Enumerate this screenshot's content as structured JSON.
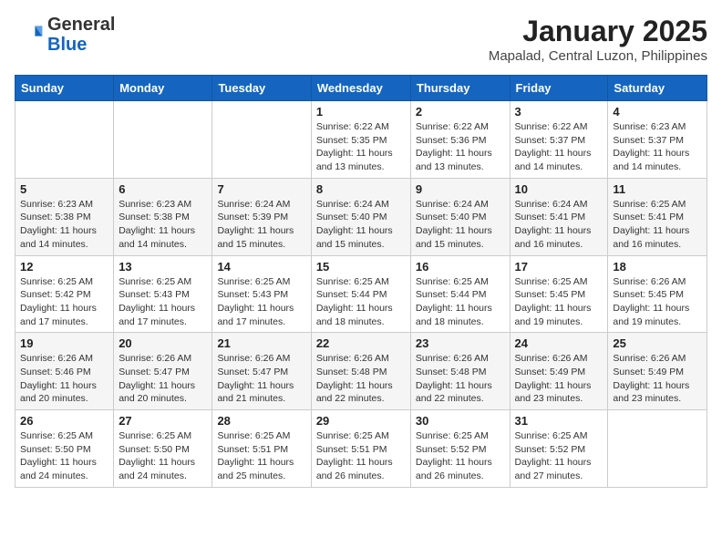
{
  "header": {
    "logo_general": "General",
    "logo_blue": "Blue",
    "month_title": "January 2025",
    "location": "Mapalad, Central Luzon, Philippines"
  },
  "days_of_week": [
    "Sunday",
    "Monday",
    "Tuesday",
    "Wednesday",
    "Thursday",
    "Friday",
    "Saturday"
  ],
  "weeks": [
    [
      {
        "day": "",
        "info": ""
      },
      {
        "day": "",
        "info": ""
      },
      {
        "day": "",
        "info": ""
      },
      {
        "day": "1",
        "info": "Sunrise: 6:22 AM\nSunset: 5:35 PM\nDaylight: 11 hours and 13 minutes."
      },
      {
        "day": "2",
        "info": "Sunrise: 6:22 AM\nSunset: 5:36 PM\nDaylight: 11 hours and 13 minutes."
      },
      {
        "day": "3",
        "info": "Sunrise: 6:22 AM\nSunset: 5:37 PM\nDaylight: 11 hours and 14 minutes."
      },
      {
        "day": "4",
        "info": "Sunrise: 6:23 AM\nSunset: 5:37 PM\nDaylight: 11 hours and 14 minutes."
      }
    ],
    [
      {
        "day": "5",
        "info": "Sunrise: 6:23 AM\nSunset: 5:38 PM\nDaylight: 11 hours and 14 minutes."
      },
      {
        "day": "6",
        "info": "Sunrise: 6:23 AM\nSunset: 5:38 PM\nDaylight: 11 hours and 14 minutes."
      },
      {
        "day": "7",
        "info": "Sunrise: 6:24 AM\nSunset: 5:39 PM\nDaylight: 11 hours and 15 minutes."
      },
      {
        "day": "8",
        "info": "Sunrise: 6:24 AM\nSunset: 5:40 PM\nDaylight: 11 hours and 15 minutes."
      },
      {
        "day": "9",
        "info": "Sunrise: 6:24 AM\nSunset: 5:40 PM\nDaylight: 11 hours and 15 minutes."
      },
      {
        "day": "10",
        "info": "Sunrise: 6:24 AM\nSunset: 5:41 PM\nDaylight: 11 hours and 16 minutes."
      },
      {
        "day": "11",
        "info": "Sunrise: 6:25 AM\nSunset: 5:41 PM\nDaylight: 11 hours and 16 minutes."
      }
    ],
    [
      {
        "day": "12",
        "info": "Sunrise: 6:25 AM\nSunset: 5:42 PM\nDaylight: 11 hours and 17 minutes."
      },
      {
        "day": "13",
        "info": "Sunrise: 6:25 AM\nSunset: 5:43 PM\nDaylight: 11 hours and 17 minutes."
      },
      {
        "day": "14",
        "info": "Sunrise: 6:25 AM\nSunset: 5:43 PM\nDaylight: 11 hours and 17 minutes."
      },
      {
        "day": "15",
        "info": "Sunrise: 6:25 AM\nSunset: 5:44 PM\nDaylight: 11 hours and 18 minutes."
      },
      {
        "day": "16",
        "info": "Sunrise: 6:25 AM\nSunset: 5:44 PM\nDaylight: 11 hours and 18 minutes."
      },
      {
        "day": "17",
        "info": "Sunrise: 6:25 AM\nSunset: 5:45 PM\nDaylight: 11 hours and 19 minutes."
      },
      {
        "day": "18",
        "info": "Sunrise: 6:26 AM\nSunset: 5:45 PM\nDaylight: 11 hours and 19 minutes."
      }
    ],
    [
      {
        "day": "19",
        "info": "Sunrise: 6:26 AM\nSunset: 5:46 PM\nDaylight: 11 hours and 20 minutes."
      },
      {
        "day": "20",
        "info": "Sunrise: 6:26 AM\nSunset: 5:47 PM\nDaylight: 11 hours and 20 minutes."
      },
      {
        "day": "21",
        "info": "Sunrise: 6:26 AM\nSunset: 5:47 PM\nDaylight: 11 hours and 21 minutes."
      },
      {
        "day": "22",
        "info": "Sunrise: 6:26 AM\nSunset: 5:48 PM\nDaylight: 11 hours and 22 minutes."
      },
      {
        "day": "23",
        "info": "Sunrise: 6:26 AM\nSunset: 5:48 PM\nDaylight: 11 hours and 22 minutes."
      },
      {
        "day": "24",
        "info": "Sunrise: 6:26 AM\nSunset: 5:49 PM\nDaylight: 11 hours and 23 minutes."
      },
      {
        "day": "25",
        "info": "Sunrise: 6:26 AM\nSunset: 5:49 PM\nDaylight: 11 hours and 23 minutes."
      }
    ],
    [
      {
        "day": "26",
        "info": "Sunrise: 6:25 AM\nSunset: 5:50 PM\nDaylight: 11 hours and 24 minutes."
      },
      {
        "day": "27",
        "info": "Sunrise: 6:25 AM\nSunset: 5:50 PM\nDaylight: 11 hours and 24 minutes."
      },
      {
        "day": "28",
        "info": "Sunrise: 6:25 AM\nSunset: 5:51 PM\nDaylight: 11 hours and 25 minutes."
      },
      {
        "day": "29",
        "info": "Sunrise: 6:25 AM\nSunset: 5:51 PM\nDaylight: 11 hours and 26 minutes."
      },
      {
        "day": "30",
        "info": "Sunrise: 6:25 AM\nSunset: 5:52 PM\nDaylight: 11 hours and 26 minutes."
      },
      {
        "day": "31",
        "info": "Sunrise: 6:25 AM\nSunset: 5:52 PM\nDaylight: 11 hours and 27 minutes."
      },
      {
        "day": "",
        "info": ""
      }
    ]
  ]
}
